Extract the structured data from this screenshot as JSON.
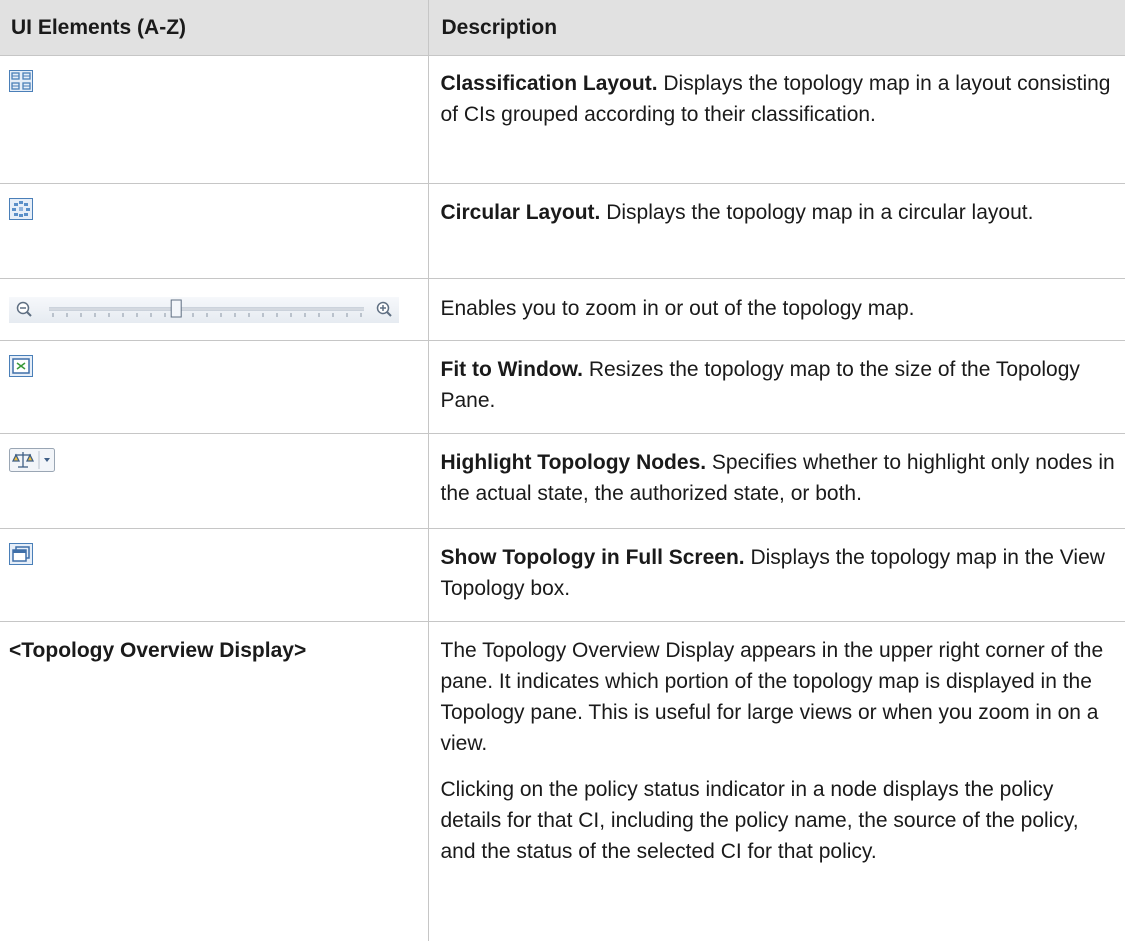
{
  "table": {
    "headers": {
      "elements": "UI Elements (A-Z)",
      "description": "Description"
    },
    "rows": [
      {
        "element_icon": "classification-layout-icon",
        "desc_bold": "Classification Layout.",
        "desc_text": " Displays the topology map in a layout consisting of CIs grouped according to their classification."
      },
      {
        "element_icon": "circular-layout-icon",
        "desc_bold": "Circular Layout.",
        "desc_text": " Displays the topology map in a circular layout."
      },
      {
        "element_icon": "zoom-slider",
        "desc_bold": "",
        "desc_text": "Enables you to zoom in or out of the topology map."
      },
      {
        "element_icon": "fit-to-window-icon",
        "desc_bold": "Fit to Window.",
        "desc_text": " Resizes the topology map to the size of the Topology Pane."
      },
      {
        "element_icon": "highlight-topology-nodes-icon",
        "desc_bold": "Highlight Topology Nodes.",
        "desc_text": " Specifies whether to highlight only nodes in the actual state, the authorized state, or both."
      },
      {
        "element_icon": "full-screen-icon",
        "desc_bold": "Show Topology in Full Screen.",
        "desc_text": " Displays the topology map in the View Topology box."
      },
      {
        "element_label": "<Topology Overview Display>",
        "desc_paragraphs": [
          "The Topology Overview Display appears in the upper right corner of the pane. It indicates which portion of the topology map is displayed in the Topology pane. This is useful for large views or when you zoom in on a view.",
          "Clicking on the policy status indicator in a node displays the policy details for that CI, including the policy name, the source of the policy, and the status of the selected CI for that policy."
        ]
      }
    ]
  },
  "colors": {
    "header_bg": "#e1e1e1",
    "border": "#c6c6c6",
    "icon_blue": "#4a7fb8"
  },
  "zoom_slider": {
    "level": 0.4
  }
}
